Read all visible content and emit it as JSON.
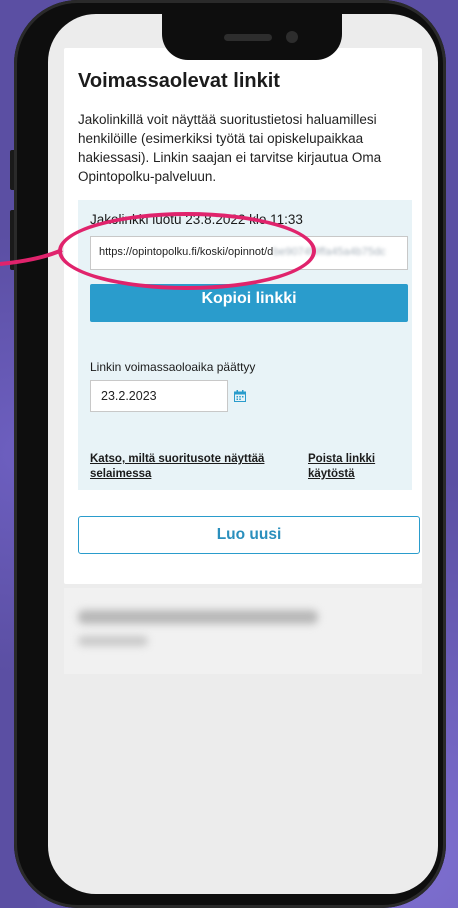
{
  "page": {
    "title": "Voimassaolevat linkit",
    "description": "Jakolinkillä voit näyttää suoritustietosi haluamillesi henkilöille (esimerkiksi työtä tai opiskelupaikkaa hakiessasi). Linkin saajan ei tarvitse kirjautua Oma Opintopolku-palveluun."
  },
  "link_panel": {
    "created": "Jakolinkki luotu 23.8.2022 klo 11:33",
    "link_prefix": "https://opintopolku.fi/koski/opinnot/d",
    "link_rest": "be9074f9ffa45a4b75dc",
    "copy_button": "Kopioi linkki",
    "expire_label": "Linkin voimassaoloaika päättyy",
    "expire_date": "23.2.2023",
    "view_link": "Katso, miltä suoritusote näyttää selaimessa",
    "remove_link": "Poista linkki käytöstä"
  },
  "actions": {
    "new_button": "Luo uusi"
  },
  "icons": {
    "calendar": "calendar-icon"
  },
  "colors": {
    "primary": "#2a9ccc",
    "highlight": "#e0236c",
    "panel_bg": "#e8f3f7"
  }
}
